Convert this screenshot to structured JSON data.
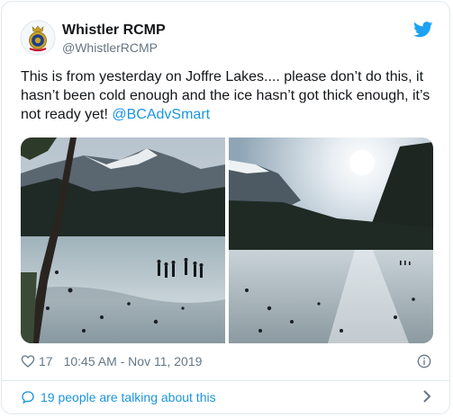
{
  "tweet": {
    "display_name": "Whistler RCMP",
    "handle": "@WhistlerRCMP",
    "text": "This is from yesterday on Joffre Lakes.... please don’t do this, it hasn’t been cold enough and the ice hasn’t got thick enough, it’s not ready yet! ",
    "mention": "@BCAdvSmart",
    "like_count": "17",
    "timestamp": "10:45 AM - Nov 11, 2019",
    "conversation_link": "19 people are talking about this"
  },
  "icons": {
    "avatar": "rcmp-crest",
    "platform": "twitter-bird-icon",
    "like": "heart-icon",
    "info": "info-icon",
    "conversation": "speech-bubble-icon",
    "more": "chevron-right-icon"
  },
  "colors": {
    "accent": "#1b95e0",
    "muted": "#657786",
    "text": "#14171a",
    "border": "#e1e8ed"
  }
}
